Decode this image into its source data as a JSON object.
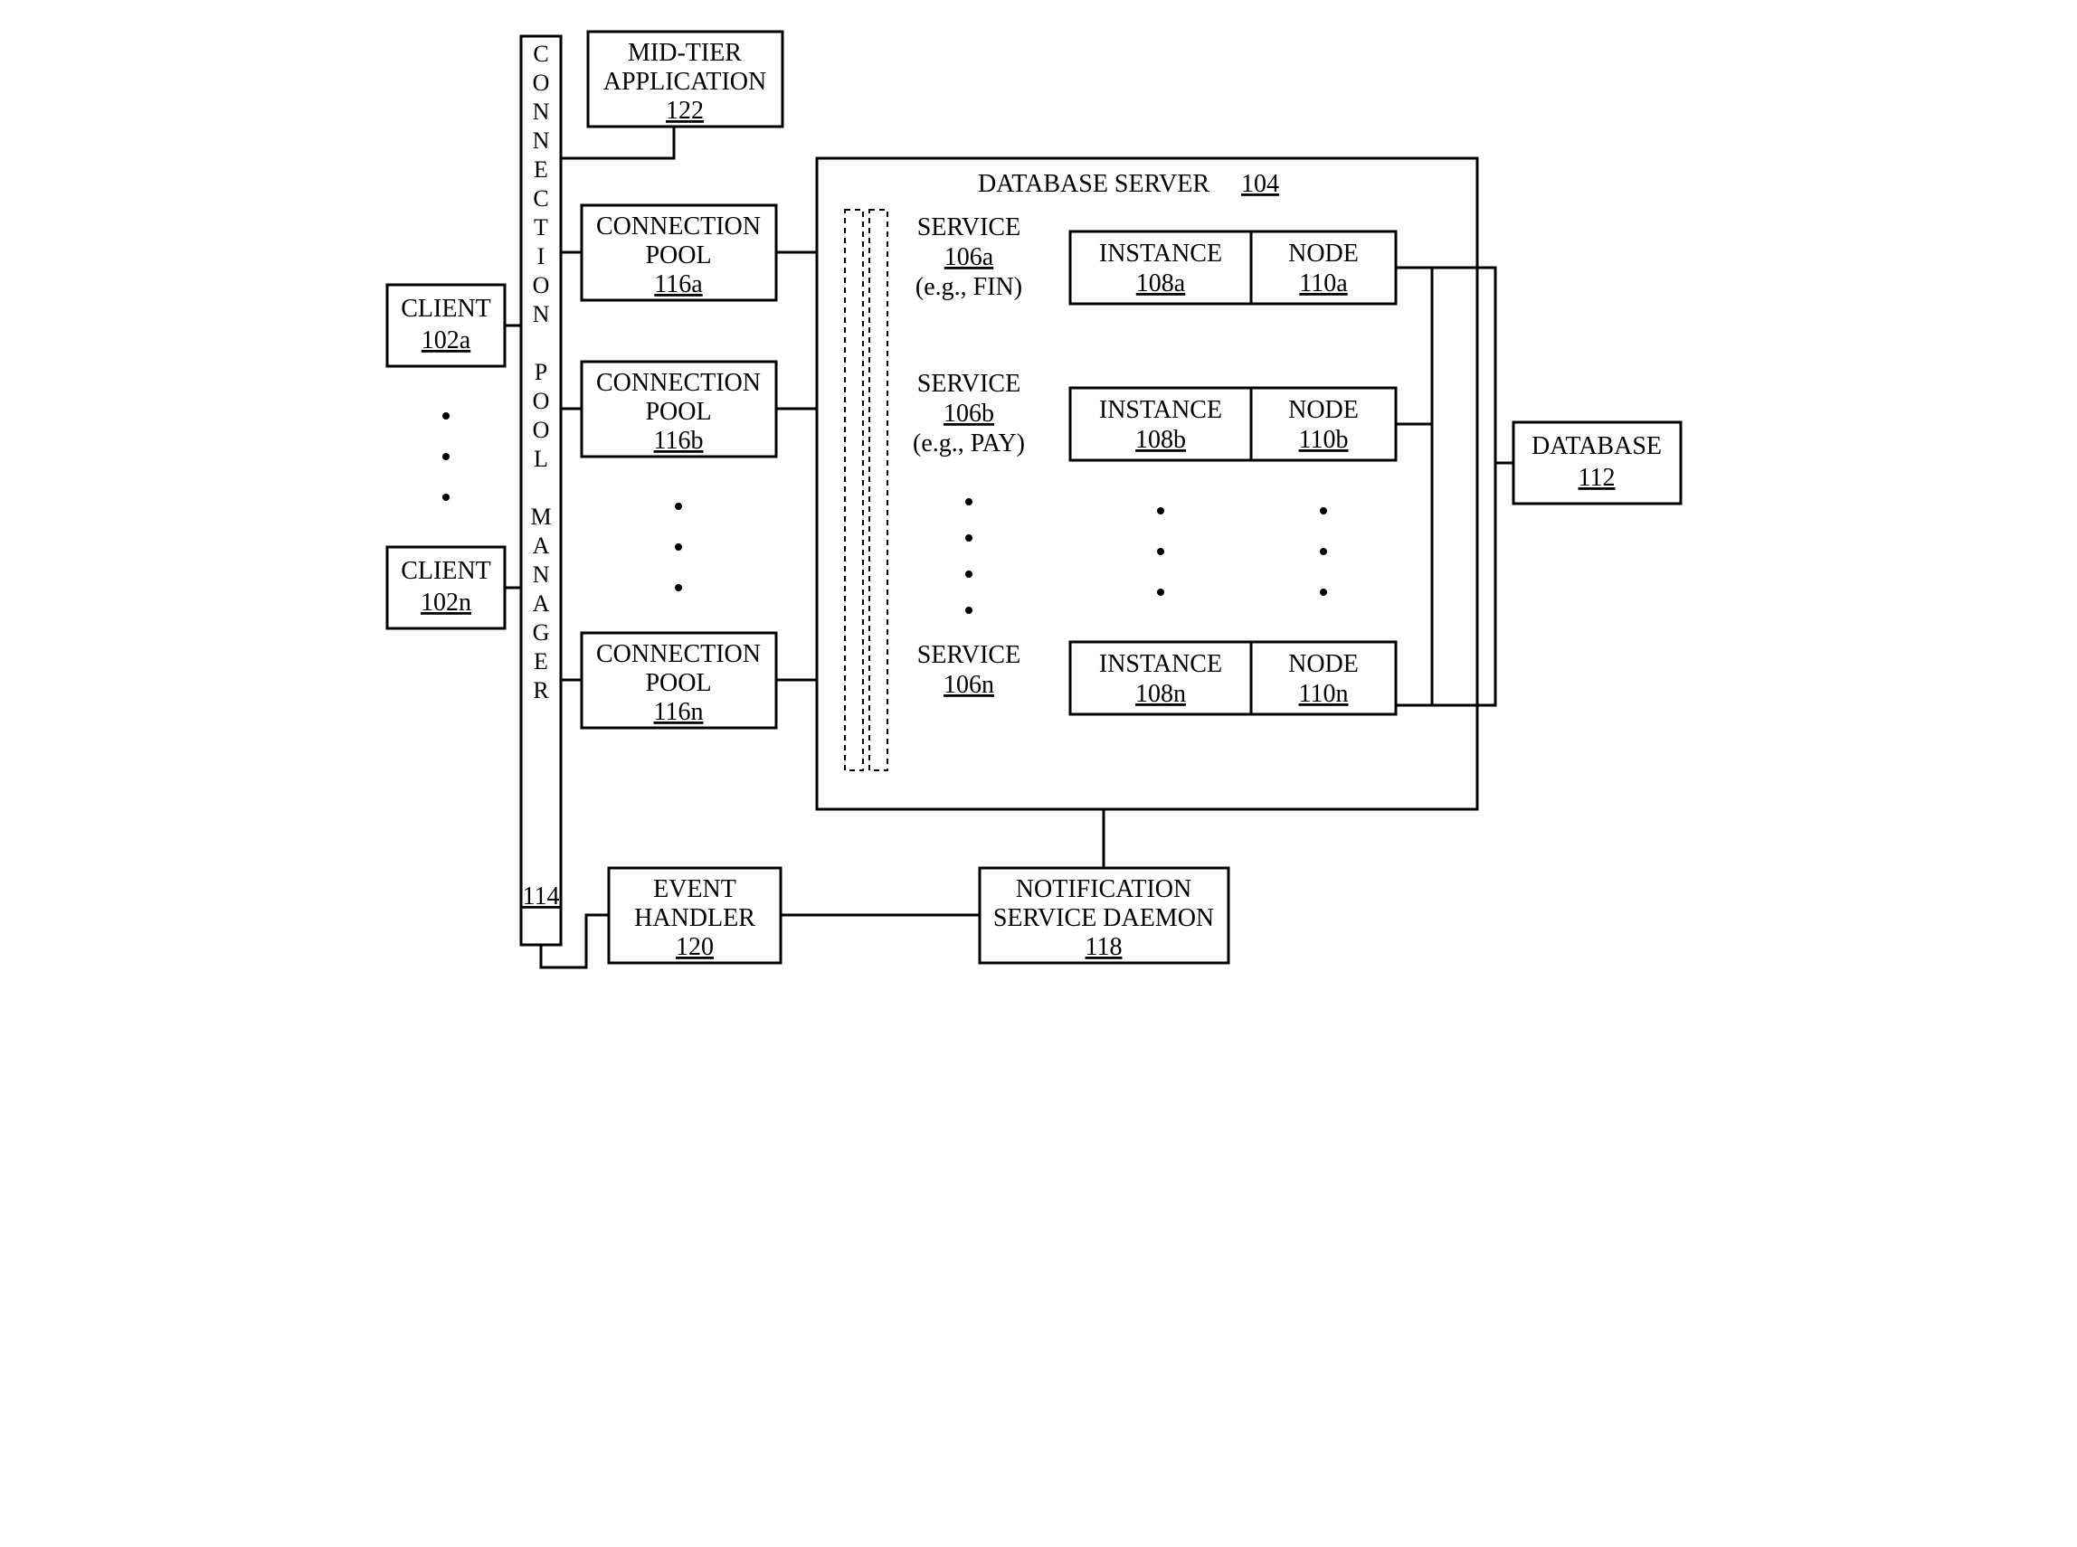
{
  "clients": [
    {
      "label": "CLIENT",
      "num": "102a"
    },
    {
      "label": "CLIENT",
      "num": "102n"
    }
  ],
  "connection_pool_manager": {
    "vertical_label": "CONNECTION POOL MANAGER",
    "num": "114"
  },
  "mid_tier": {
    "label_line1": "MID-TIER",
    "label_line2": "APPLICATION",
    "num": "122"
  },
  "connection_pools": [
    {
      "label_line1": "CONNECTION",
      "label_line2": "POOL",
      "num": "116a"
    },
    {
      "label_line1": "CONNECTION",
      "label_line2": "POOL",
      "num": "116b"
    },
    {
      "label_line1": "CONNECTION",
      "label_line2": "POOL",
      "num": "116n"
    }
  ],
  "database_server": {
    "label": "DATABASE SERVER",
    "num": "104"
  },
  "services": [
    {
      "label": "SERVICE",
      "num": "106a",
      "eg": "(e.g., FIN)"
    },
    {
      "label": "SERVICE",
      "num": "106b",
      "eg": "(e.g., PAY)"
    },
    {
      "label": "SERVICE",
      "num": "106n",
      "eg": ""
    }
  ],
  "instances": [
    {
      "label": "INSTANCE",
      "num": "108a"
    },
    {
      "label": "INSTANCE",
      "num": "108b"
    },
    {
      "label": "INSTANCE",
      "num": "108n"
    }
  ],
  "nodes": [
    {
      "label": "NODE",
      "num": "110a"
    },
    {
      "label": "NODE",
      "num": "110b"
    },
    {
      "label": "NODE",
      "num": "110n"
    }
  ],
  "database": {
    "label": "DATABASE",
    "num": "112"
  },
  "event_handler": {
    "label_line1": "EVENT",
    "label_line2": "HANDLER",
    "num": "120"
  },
  "notification_daemon": {
    "label_line1": "NOTIFICATION",
    "label_line2": "SERVICE DAEMON",
    "num": "118"
  }
}
